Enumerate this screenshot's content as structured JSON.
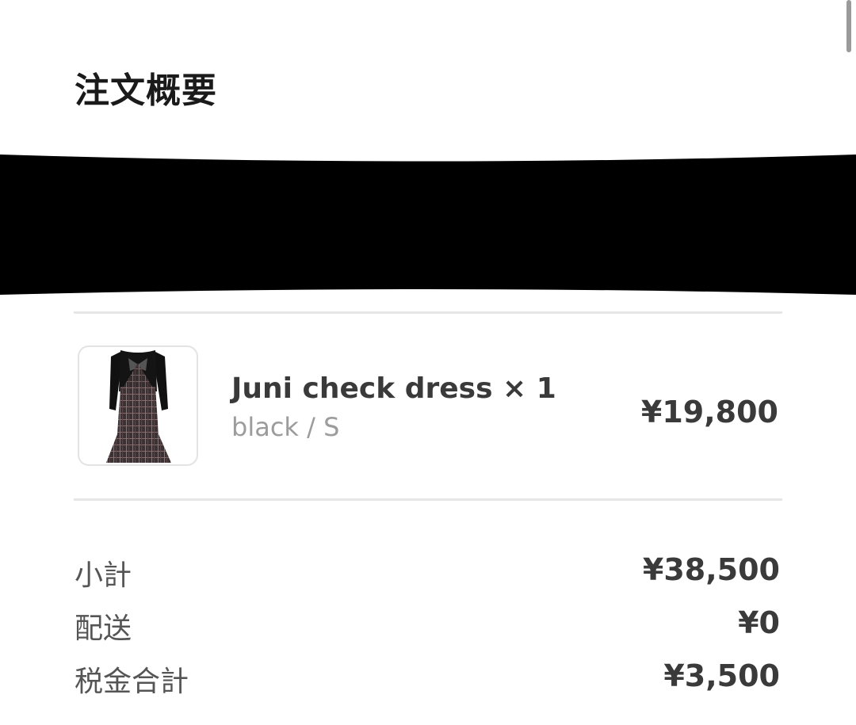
{
  "title": "注文概要",
  "item": {
    "name": "Juni check dress × 1",
    "variant": "black / S",
    "price": "¥19,800",
    "thumbnail_icon": "dress-product-image"
  },
  "summary": [
    {
      "label": "小計",
      "value": "¥38,500"
    },
    {
      "label": "配送",
      "value": "¥0"
    },
    {
      "label": "税金合計",
      "value": "¥3,500"
    }
  ]
}
